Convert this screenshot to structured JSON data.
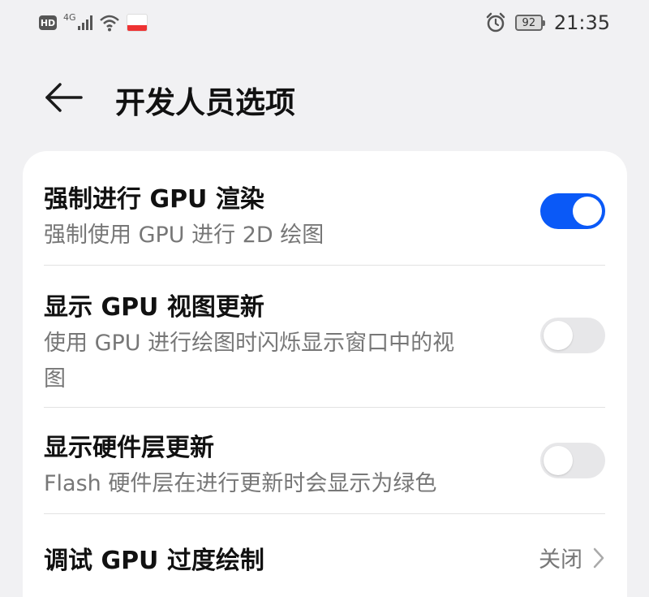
{
  "status_bar": {
    "hd": "HD",
    "network": "4G",
    "battery": "92",
    "time": "21:35"
  },
  "header": {
    "title": "开发人员选项"
  },
  "settings": [
    {
      "title": "强制进行 GPU 渲染",
      "subtitle": "强制使用 GPU 进行 2D 绘图",
      "toggle": true
    },
    {
      "title": "显示 GPU 视图更新",
      "subtitle_line1": "使用 GPU 进行绘图时闪烁显示窗口中的视",
      "subtitle_line2": "图",
      "toggle": false
    },
    {
      "title": "显示硬件层更新",
      "subtitle": "Flash 硬件层在进行更新时会显示为绿色",
      "toggle": false
    },
    {
      "title": "调试 GPU 过度绘制",
      "value": "关闭"
    }
  ],
  "colors": {
    "accent": "#0a59f7",
    "background": "#f1f1f3",
    "card": "#ffffff",
    "secondary_text": "#777777"
  }
}
